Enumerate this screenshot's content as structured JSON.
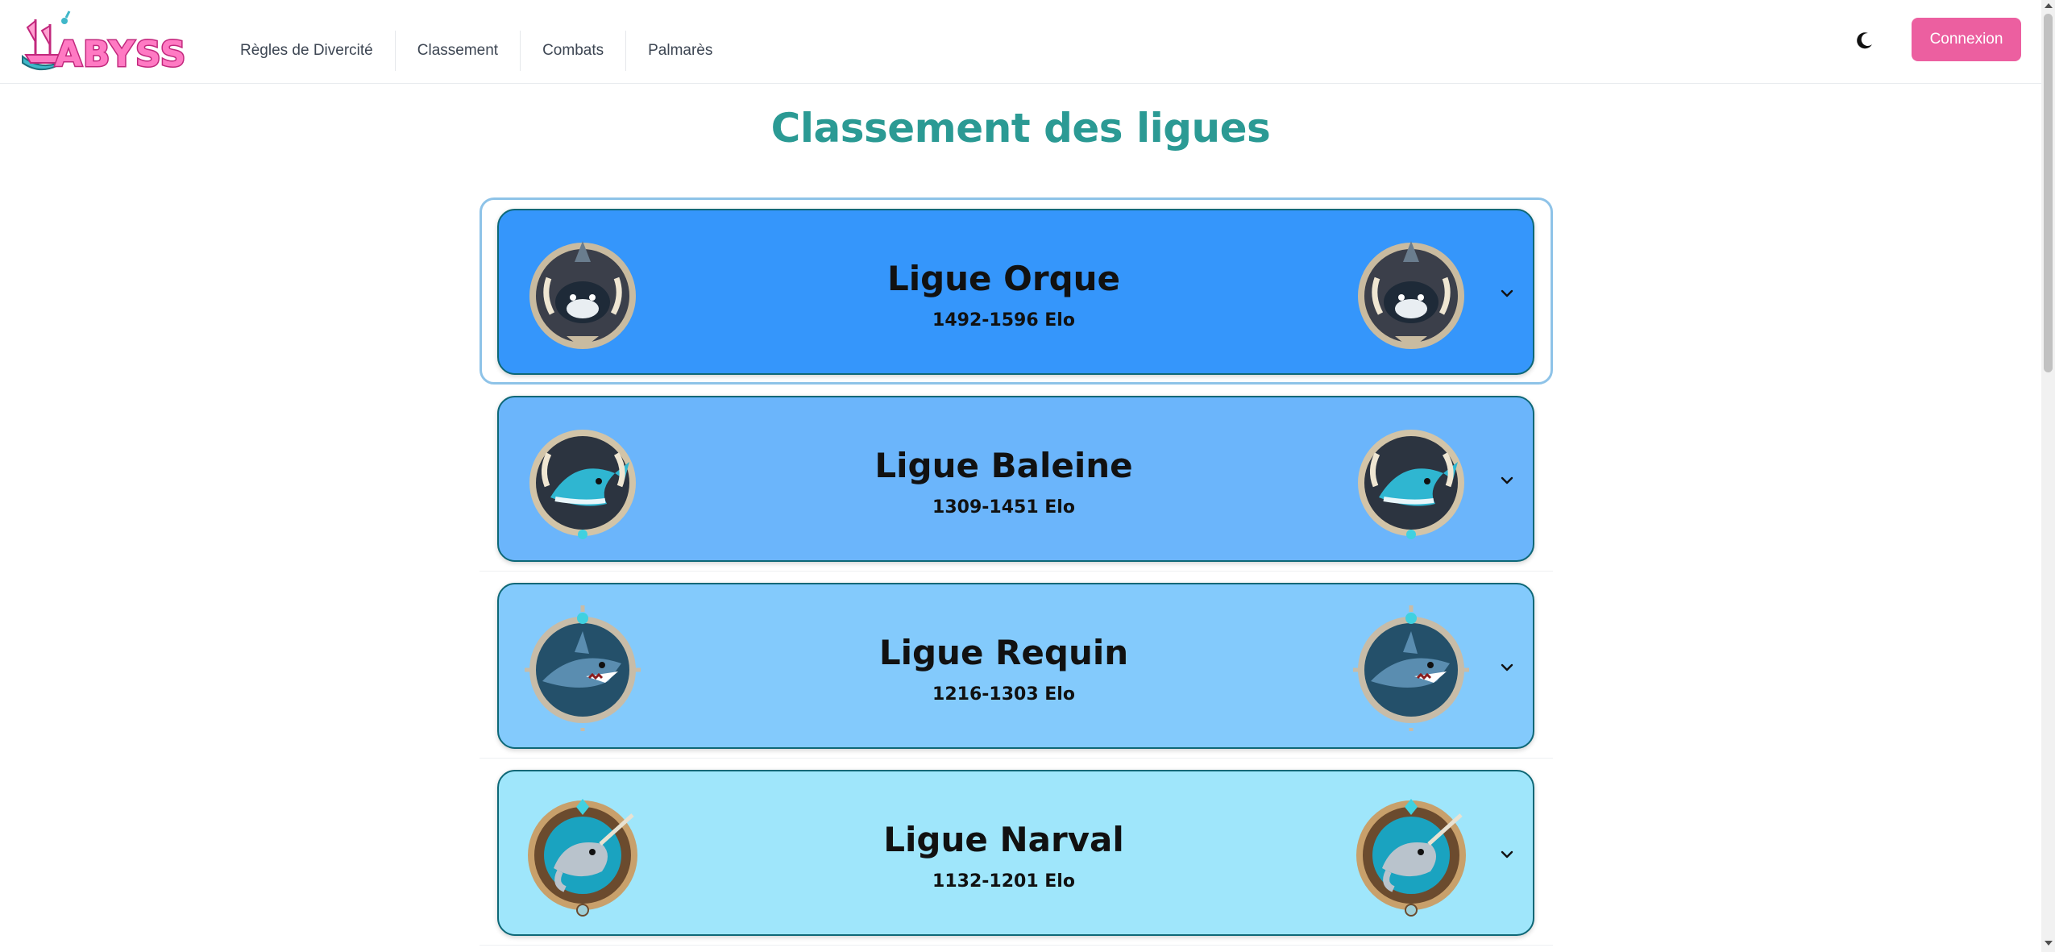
{
  "header": {
    "logo_text": "ABYSS",
    "nav": [
      "Règles de Divercité",
      "Classement",
      "Combats",
      "Palmarès"
    ],
    "login_label": "Connexion"
  },
  "page": {
    "title": "Classement des ligues"
  },
  "leagues": [
    {
      "name": "Ligue Orque",
      "elo": "1492-1596 Elo",
      "color": "#3596fb",
      "emblem": "orca-emblem-icon"
    },
    {
      "name": "Ligue Baleine",
      "elo": "1309-1451 Elo",
      "color": "#6bb5fb",
      "emblem": "whale-emblem-icon"
    },
    {
      "name": "Ligue Requin",
      "elo": "1216-1303 Elo",
      "color": "#83cafc",
      "emblem": "shark-emblem-icon"
    },
    {
      "name": "Ligue Narval",
      "elo": "1132-1201 Elo",
      "color": "#9fe6fb",
      "emblem": "narwhal-emblem-icon"
    }
  ],
  "colors": {
    "accent_pink": "#ec5fa0",
    "title_teal": "#2b9a94",
    "card_border": "#0e6877"
  }
}
